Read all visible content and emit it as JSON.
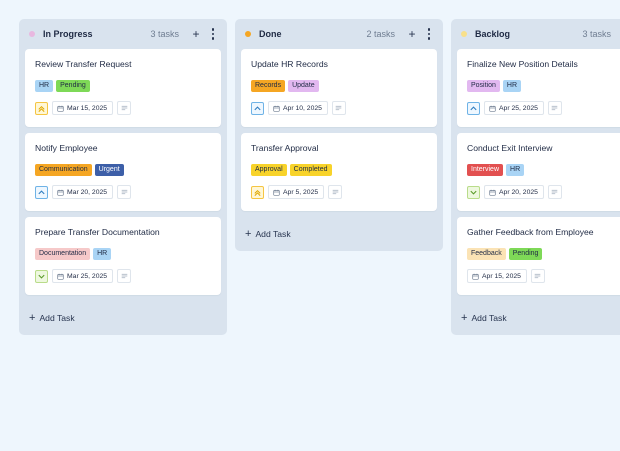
{
  "add_task_label": "Add Task",
  "columns": [
    {
      "title": "In Progress",
      "count": "3 tasks",
      "dot_color": "#e8b8e0",
      "cards": [
        {
          "title": "Review Transfer Request",
          "tags": [
            {
              "label": "HR",
              "color": "#a9d4f5"
            },
            {
              "label": "Pending",
              "color": "#7ed957"
            }
          ],
          "priority": "high",
          "date": "Mar 15, 2025"
        },
        {
          "title": "Notify Employee",
          "tags": [
            {
              "label": "Communication",
              "color": "#f5a623"
            },
            {
              "label": "Urgent",
              "color": "#3d5fa8",
              "text_color": "#ffffff"
            }
          ],
          "priority": "medium",
          "date": "Mar 20, 2025"
        },
        {
          "title": "Prepare Transfer Documentation",
          "tags": [
            {
              "label": "Documentation",
              "color": "#f6c9c9"
            },
            {
              "label": "HR",
              "color": "#a9d4f5"
            }
          ],
          "priority": "low",
          "date": "Mar 25, 2025"
        }
      ]
    },
    {
      "title": "Done",
      "count": "2 tasks",
      "dot_color": "#f5a623",
      "cards": [
        {
          "title": "Update HR Records",
          "tags": [
            {
              "label": "Records",
              "color": "#f5a623"
            },
            {
              "label": "Update",
              "color": "#e2b8f0"
            }
          ],
          "priority": "medium",
          "date": "Apr 10, 2025"
        },
        {
          "title": "Transfer Approval",
          "tags": [
            {
              "label": "Approval",
              "color": "#f8d32a"
            },
            {
              "label": "Completed",
              "color": "#f8d32a"
            }
          ],
          "priority": "high",
          "date": "Apr 5, 2025"
        }
      ]
    },
    {
      "title": "Backlog",
      "count": "3 tasks",
      "dot_color": "#f8e08a",
      "cards": [
        {
          "title": "Finalize New Position Details",
          "tags": [
            {
              "label": "Position",
              "color": "#e2b8f0"
            },
            {
              "label": "HR",
              "color": "#a9d4f5"
            }
          ],
          "priority": "medium",
          "date": "Apr 25, 2025"
        },
        {
          "title": "Conduct Exit Interview",
          "tags": [
            {
              "label": "Interview",
              "color": "#e25050",
              "text_color": "#ffffff"
            },
            {
              "label": "HR",
              "color": "#a9d4f5"
            }
          ],
          "priority": "low",
          "date": "Apr 20, 2025"
        },
        {
          "title": "Gather Feedback from Employee",
          "tags": [
            {
              "label": "Feedback",
              "color": "#fbe3b5"
            },
            {
              "label": "Pending",
              "color": "#7ed957"
            }
          ],
          "priority": "none",
          "date": "Apr 15, 2025"
        }
      ]
    }
  ]
}
